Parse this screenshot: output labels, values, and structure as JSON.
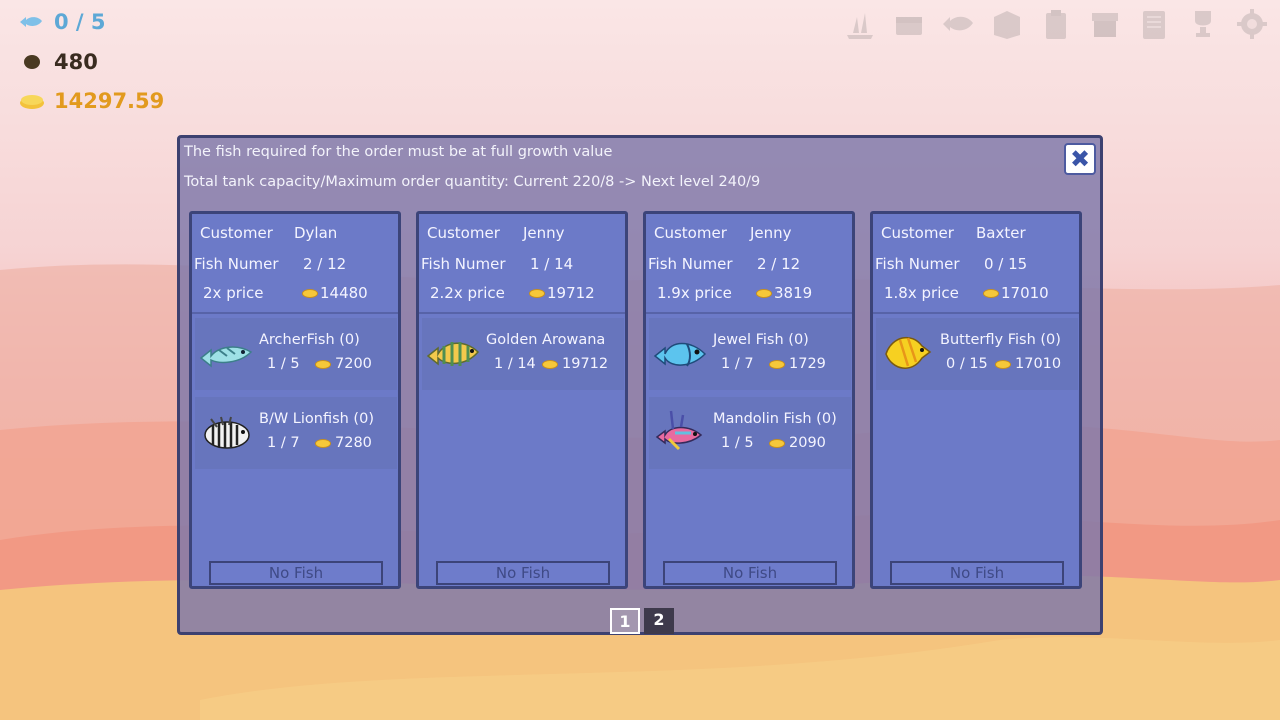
{
  "hud": {
    "fish_count": "0 / 5",
    "food": "480",
    "gold": "14297.59"
  },
  "toolbar": [
    "decor-icon",
    "chest-icon",
    "fish-icon",
    "box-icon",
    "clipboard-icon",
    "shop-icon",
    "book-icon",
    "trophy-icon",
    "gear-icon"
  ],
  "modal": {
    "line1": "The fish required for the order must be at full growth value",
    "line2": "Total tank capacity/Maximum order quantity: Current 220/8 -> Next level 240/9",
    "close": "✖"
  },
  "orders": [
    {
      "customer_label": "Customer",
      "customer": "Dylan",
      "fish_label": "Fish Numer",
      "fish_number": "2 / 12",
      "price_mult": "2x price",
      "total": "14480",
      "fish": [
        {
          "name": "ArcherFish (0)",
          "qty": "1 / 5",
          "price": "7200",
          "icon": "archerfish-icon"
        },
        {
          "name": "B/W Lionfish (0)",
          "qty": "1 / 7",
          "price": "7280",
          "icon": "lionfish-icon"
        }
      ],
      "button": "No Fish"
    },
    {
      "customer_label": "Customer",
      "customer": "Jenny",
      "fish_label": "Fish Numer",
      "fish_number": "1 / 14",
      "price_mult": "2.2x price",
      "total": "19712",
      "fish": [
        {
          "name": "Golden Arowana",
          "qty": "1 / 14",
          "price": "19712",
          "icon": "arowana-icon"
        }
      ],
      "button": "No Fish"
    },
    {
      "customer_label": "Customer",
      "customer": "Jenny",
      "fish_label": "Fish Numer",
      "fish_number": "2 / 12",
      "price_mult": "1.9x price",
      "total": "3819",
      "fish": [
        {
          "name": "Jewel Fish (0)",
          "qty": "1 / 7",
          "price": "1729",
          "icon": "jewelfish-icon"
        },
        {
          "name": "Mandolin Fish (0)",
          "qty": "1 / 5",
          "price": "2090",
          "icon": "mandolinfish-icon"
        }
      ],
      "button": "No Fish"
    },
    {
      "customer_label": "Customer",
      "customer": "Baxter",
      "fish_label": "Fish Numer",
      "fish_number": "0 / 15",
      "price_mult": "1.8x price",
      "total": "17010",
      "fish": [
        {
          "name": "Butterfly Fish (0)",
          "qty": "0 / 15",
          "price": "17010",
          "icon": "butterflyfish-icon"
        }
      ],
      "button": "No Fish"
    }
  ],
  "pages": [
    "1",
    "2"
  ],
  "active_page": "1",
  "colors": {
    "gold": "#e29a1e",
    "fish_hud": "#5da8d6",
    "panel": "#6c7ac8"
  }
}
